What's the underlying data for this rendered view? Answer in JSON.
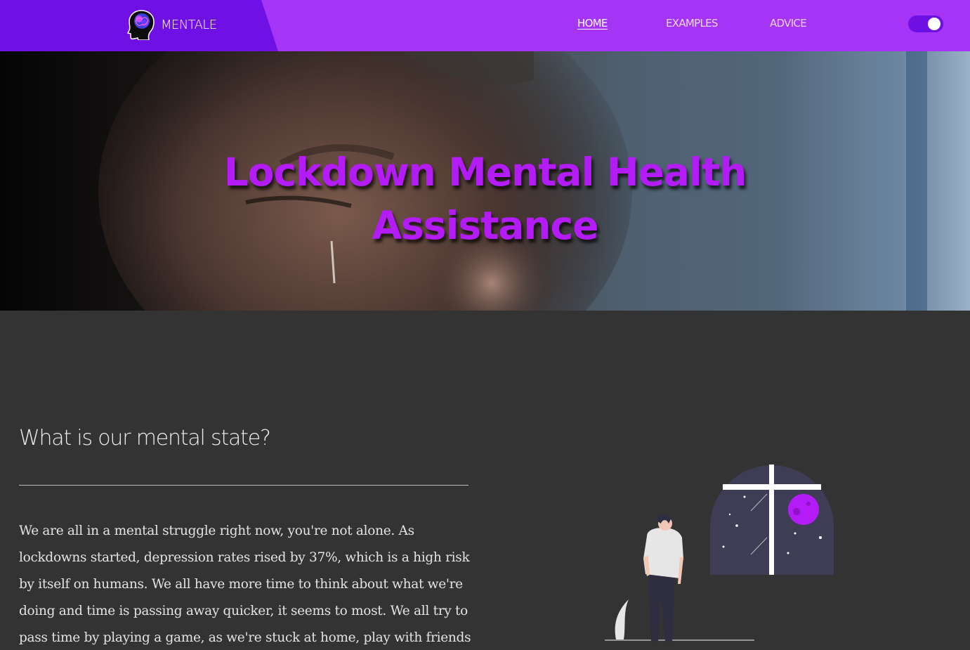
{
  "nav": {
    "brand": "MENTALE",
    "links": [
      {
        "label": "HOME",
        "active": true
      },
      {
        "label": "EXAMPLES",
        "active": false
      },
      {
        "label": "ADVICE",
        "active": false
      }
    ],
    "theme_toggle": {
      "on": true
    },
    "colors": {
      "bar": "#a534f7",
      "brand_panel": "#6f10e4"
    }
  },
  "hero": {
    "title_line1": "Lockdown Mental Health",
    "title_line2": "Assistance",
    "title_color": "#b31cf7"
  },
  "section": {
    "title": "What is our mental state?",
    "body": "We are all in a mental struggle right now, you're not alone. As lockdowns started, depression rates rised by 37%, which is a high risk by itself on humans. We all have more time to think about what we're doing and time is passing away quicker, it seems to most. We all try to pass time by playing a game, as we're stuck at home, play with friends or be with our"
  },
  "icons": {
    "brand_logo": "head-brain-icon",
    "illustration": "person-looking-at-night-window-illustration"
  }
}
